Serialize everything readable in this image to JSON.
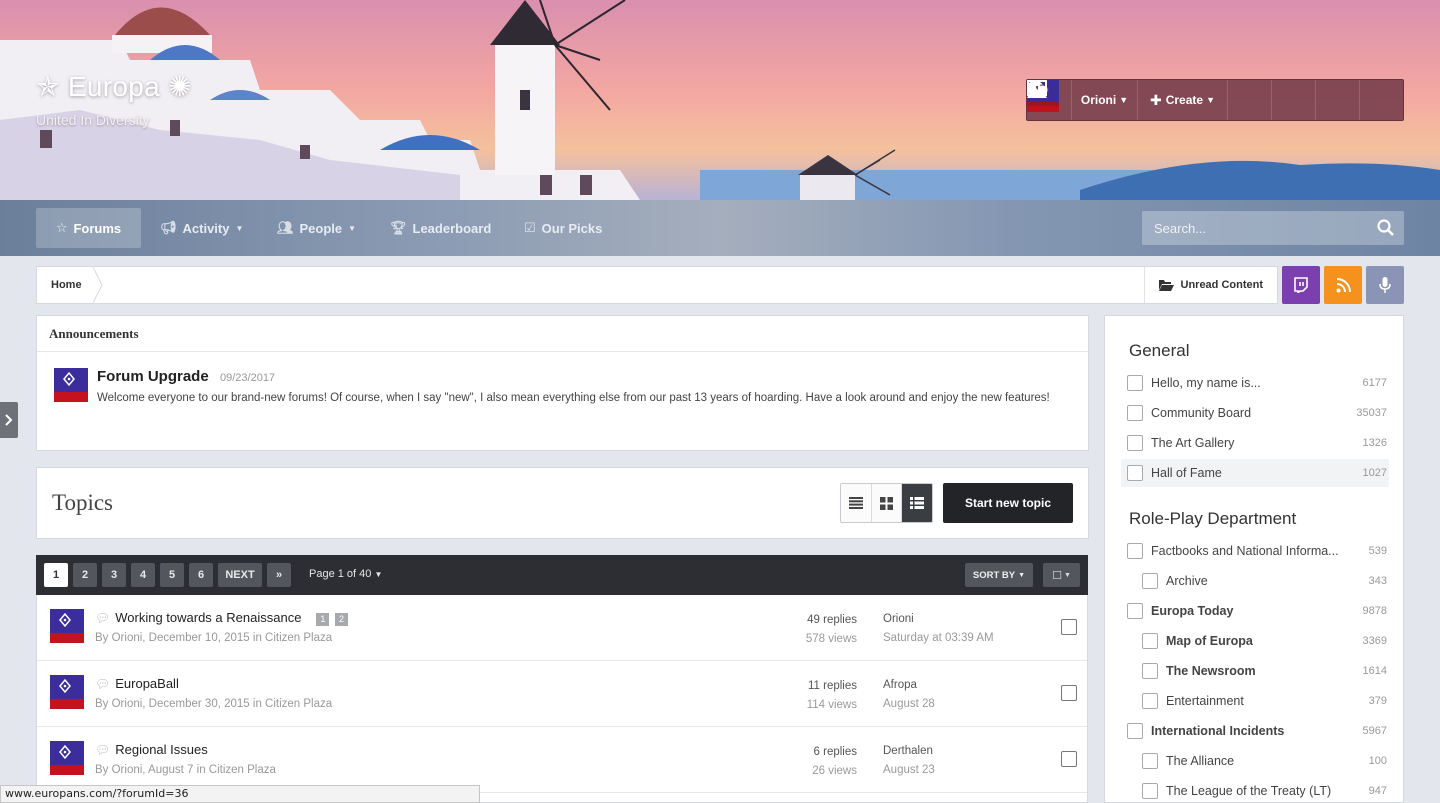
{
  "header": {
    "site_title": "Europa",
    "tagline": "United In Diversity"
  },
  "userbar": {
    "username": "Orioni",
    "create_label": "Create"
  },
  "nav": {
    "items": [
      {
        "label": "Forums",
        "icon": "star-icon",
        "active": true
      },
      {
        "label": "Activity",
        "icon": "megaphone-icon",
        "dropdown": true
      },
      {
        "label": "People",
        "icon": "users-icon",
        "dropdown": true
      },
      {
        "label": "Leaderboard",
        "icon": "trophy-icon"
      },
      {
        "label": "Our Picks",
        "icon": "check-square-icon"
      }
    ],
    "search_placeholder": "Search..."
  },
  "breadcrumb": {
    "home": "Home",
    "unread": "Unread Content"
  },
  "colors": {
    "twitch": "#7b3fb0",
    "rss": "#f5921e",
    "mic": "#8a95b5",
    "accent_dark": "#222428"
  },
  "announcements": {
    "heading": "Announcements",
    "title": "Forum Upgrade",
    "date": "09/23/2017",
    "body": "Welcome everyone to our brand-new forums! Of course, when I say \"new\", I also mean everything else from our past 13 years of hoarding. Have a look around and enjoy the new features!"
  },
  "topics": {
    "heading": "Topics",
    "start_new": "Start new topic",
    "pages": [
      "1",
      "2",
      "3",
      "4",
      "5",
      "6"
    ],
    "next": "NEXT",
    "last": "»",
    "page_label": "Page 1 of 40",
    "sort_by": "SORT BY",
    "rows": [
      {
        "title": "Working towards a Renaissance",
        "pages": [
          "1",
          "2"
        ],
        "meta": "By Orioni, December 10, 2015 in Citizen Plaza",
        "replies": "49 replies",
        "views": "578 views",
        "last_user": "Orioni",
        "last_date": "Saturday at 03:39 AM"
      },
      {
        "title": "EuropaBall",
        "meta": "By Orioni, December 30, 2015 in Citizen Plaza",
        "replies": "11 replies",
        "views": "114 views",
        "last_user": "Afropa",
        "last_date": "August 28"
      },
      {
        "title": "Regional Issues",
        "meta": "By Orioni, August 7 in Citizen Plaza",
        "replies": "6 replies",
        "views": "26 views",
        "last_user": "Derthalen",
        "last_date": "August 23"
      }
    ]
  },
  "sidebar": {
    "categories": [
      {
        "name": "General",
        "forums": [
          {
            "name": "Hello, my name is...",
            "count": "6177"
          },
          {
            "name": "Community Board",
            "count": "35037"
          },
          {
            "name": "The Art Gallery",
            "count": "1326"
          },
          {
            "name": "Hall of Fame",
            "count": "1027"
          }
        ]
      },
      {
        "name": "Role-Play Department",
        "forums": [
          {
            "name": "Factbooks and National Informa...",
            "count": "539"
          },
          {
            "name": "Archive",
            "count": "343"
          },
          {
            "name": "Europa Today",
            "count": "9878"
          },
          {
            "name": "Map of Europa",
            "count": "3369"
          },
          {
            "name": "The Newsroom",
            "count": "1614"
          },
          {
            "name": "Entertainment",
            "count": "379"
          },
          {
            "name": "International Incidents",
            "count": "5967"
          },
          {
            "name": "The Alliance",
            "count": "100"
          },
          {
            "name": "The League of the Treaty (LT)",
            "count": "947"
          }
        ]
      }
    ]
  },
  "status_bar": {
    "url": "www.europans.com/?forumId=36"
  }
}
